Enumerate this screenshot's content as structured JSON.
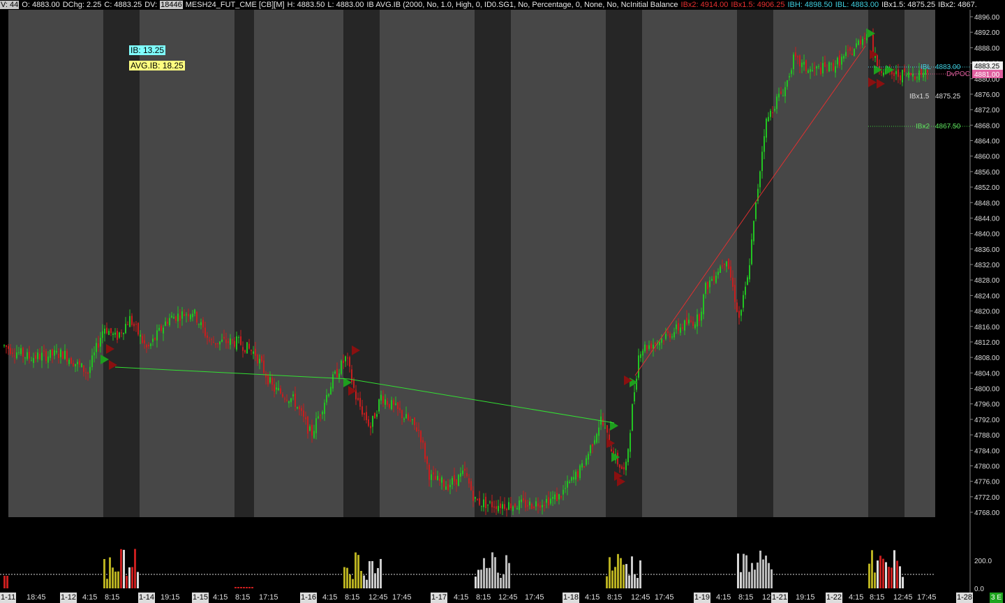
{
  "topbar": {
    "v": "V: 44",
    "open": "O: 4883.00",
    "dchg": "DChg: 2.25",
    "close": "C: 4883.25",
    "dv_label": "DV:",
    "dv_value": "18446",
    "symbol": "MESH24_FUT_CME [CB][M]",
    "high": "H: 4883.50",
    "low": "L: 4883.00",
    "study": "IB  AVG.IB  (2000, No, 1.0, High, 0, ID0.SG1, No, Percentage, 0, None, No, NcInitial Balance",
    "ibx2": "IBx2: 4914.00",
    "ibx15": "IBx1.5: 4906.25",
    "ibh": "IBH: 4898.50",
    "ibl": "IBL: 4883.00",
    "ibx15b": "IBx1.5: 4875.25",
    "ibx2b": "IBx2: 4867."
  },
  "badges": {
    "ib": "IB: 13.25",
    "avg_ib": "AVG.IB: 18.25"
  },
  "right_labels": {
    "ibl_name": "IBL",
    "ibl_value": "4883.00",
    "dvpoc_name": "DvPOC",
    "dvpoc_value": "4881.00",
    "ibx15_name": "IBx1.5",
    "ibx15_value": "4875.25",
    "ibx2_name": "IBx2",
    "ibx2_value": "4867.50",
    "last_price": "4883.25"
  },
  "price_axis": [
    "4896.00",
    "4892.00",
    "4888.00",
    "4884.00",
    "4880.00",
    "4876.00",
    "4872.00",
    "4868.00",
    "4864.00",
    "4860.00",
    "4856.00",
    "4852.00",
    "4848.00",
    "4844.00",
    "4840.00",
    "4836.00",
    "4832.00",
    "4828.00",
    "4824.00",
    "4820.00",
    "4816.00",
    "4812.00",
    "4808.00",
    "4804.00",
    "4800.00",
    "4796.00",
    "4792.00",
    "4788.00",
    "4784.00",
    "4780.00",
    "4776.00",
    "4772.00",
    "4768.00"
  ],
  "volume_axis": [
    "200.0",
    "0.0"
  ],
  "time_axis": [
    {
      "t": "1-11",
      "date": true
    },
    {
      "t": "18:45"
    },
    {
      "t": "1-12",
      "date": true
    },
    {
      "t": "4:15"
    },
    {
      "t": "8:15"
    },
    {
      "t": "1-14",
      "date": true
    },
    {
      "t": "19:15"
    },
    {
      "t": "1-15",
      "date": true
    },
    {
      "t": "4:15"
    },
    {
      "t": "8:15"
    },
    {
      "t": "17:15"
    },
    {
      "t": "1-16",
      "date": true
    },
    {
      "t": "4:15"
    },
    {
      "t": "8:15"
    },
    {
      "t": "12:45"
    },
    {
      "t": "17:45"
    },
    {
      "t": "1-17",
      "date": true
    },
    {
      "t": "4:15"
    },
    {
      "t": "8:15"
    },
    {
      "t": "12:45"
    },
    {
      "t": "17:45"
    },
    {
      "t": "1-18",
      "date": true
    },
    {
      "t": "4:15"
    },
    {
      "t": "8:15"
    },
    {
      "t": "12:45"
    },
    {
      "t": "17:45"
    },
    {
      "t": "1-19",
      "date": true
    },
    {
      "t": "4:15"
    },
    {
      "t": "8:15"
    },
    {
      "t": "12:45"
    },
    {
      "t": "1-21",
      "date": true
    },
    {
      "t": "19:15"
    },
    {
      "t": "1-22",
      "date": true
    },
    {
      "t": "4:15"
    },
    {
      "t": "8:15"
    },
    {
      "t": "12:45"
    },
    {
      "t": "17:45"
    },
    {
      "t": "1-28",
      "date": true
    }
  ],
  "corner_label": "3 E",
  "colors": {
    "bg": "#000000",
    "rth_shade": "#474747",
    "eth_shade": "#262626",
    "up": "#22c422",
    "down": "#c81e1e",
    "vol_rth": "#c8c8c8",
    "vol_eth": "#b8b020",
    "ib_badge": "#80ffff",
    "avg_ib_badge": "#ffff80"
  }
}
